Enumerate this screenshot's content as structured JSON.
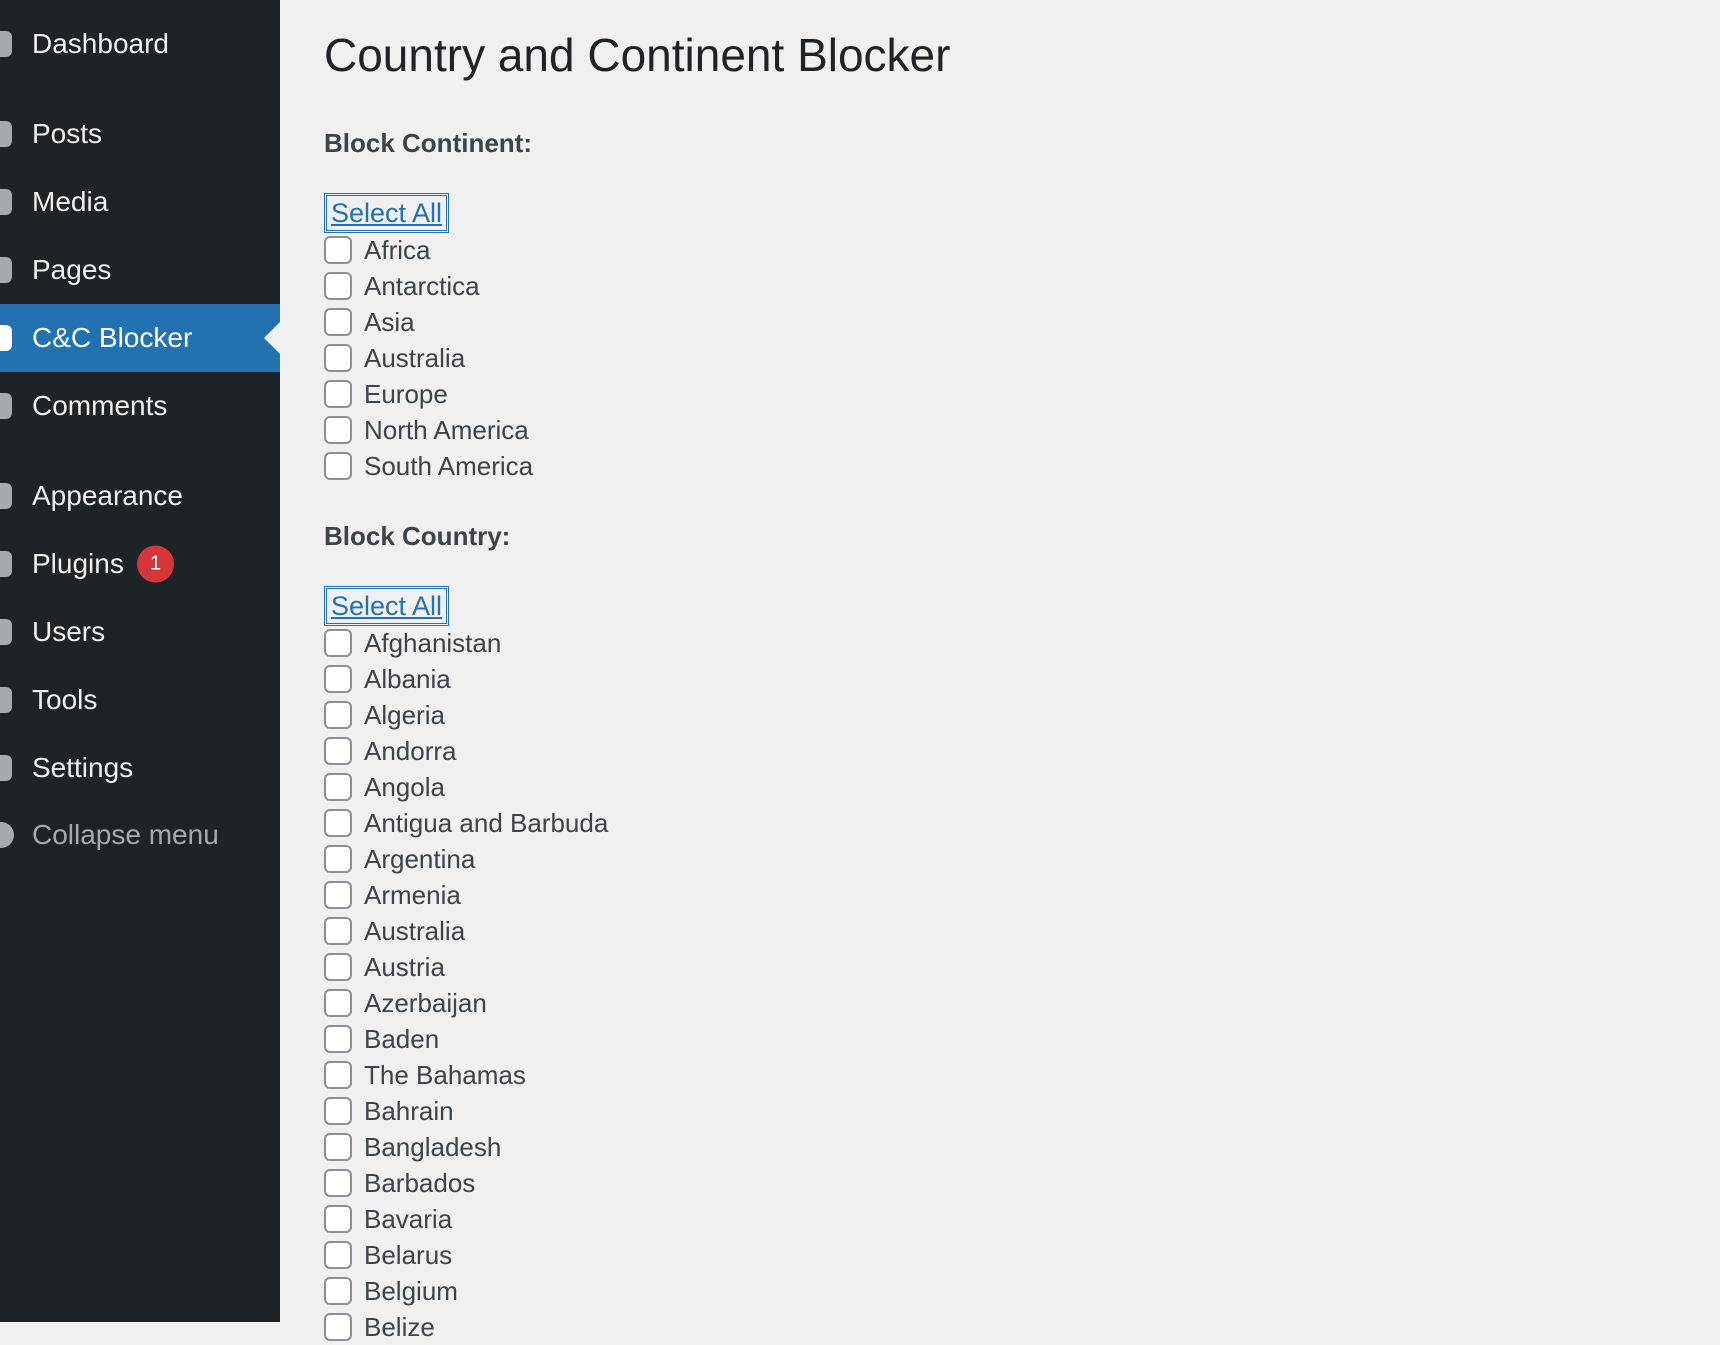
{
  "sidebar": {
    "items": [
      {
        "label": "Dashboard",
        "icon": "dashboard-icon"
      },
      {
        "label": "Posts",
        "icon": "pin-icon"
      },
      {
        "label": "Media",
        "icon": "media-icon"
      },
      {
        "label": "Pages",
        "icon": "page-icon"
      },
      {
        "label": "C&C Blocker",
        "icon": "plugin-menu-icon",
        "current": true
      },
      {
        "label": "Comments",
        "icon": "comment-icon"
      },
      {
        "label": "Appearance",
        "icon": "brush-icon"
      },
      {
        "label": "Plugins",
        "icon": "plug-icon",
        "badge": "1"
      },
      {
        "label": "Users",
        "icon": "user-icon"
      },
      {
        "label": "Tools",
        "icon": "wrench-icon"
      },
      {
        "label": "Settings",
        "icon": "settings-icon"
      },
      {
        "label": "Collapse menu",
        "icon": "collapse-icon"
      }
    ]
  },
  "colors": {
    "sidebar_bg": "#1d2327",
    "accent": "#2271b1",
    "badge": "#d63638",
    "page_bg": "#f0f0f1"
  },
  "main": {
    "title": "Country and Continent Blocker",
    "continent_section": {
      "heading": "Block Continent:",
      "select_all": "Select All",
      "options": [
        "Africa",
        "Antarctica",
        "Asia",
        "Australia",
        "Europe",
        "North America",
        "South America"
      ]
    },
    "country_section": {
      "heading": "Block Country:",
      "select_all": "Select All",
      "options": [
        "Afghanistan",
        "Albania",
        "Algeria",
        "Andorra",
        "Angola",
        "Antigua and Barbuda",
        "Argentina",
        "Armenia",
        "Australia",
        "Austria",
        "Azerbaijan",
        "Baden",
        "The Bahamas",
        "Bahrain",
        "Bangladesh",
        "Barbados",
        "Bavaria",
        "Belarus",
        "Belgium",
        "Belize"
      ]
    }
  }
}
